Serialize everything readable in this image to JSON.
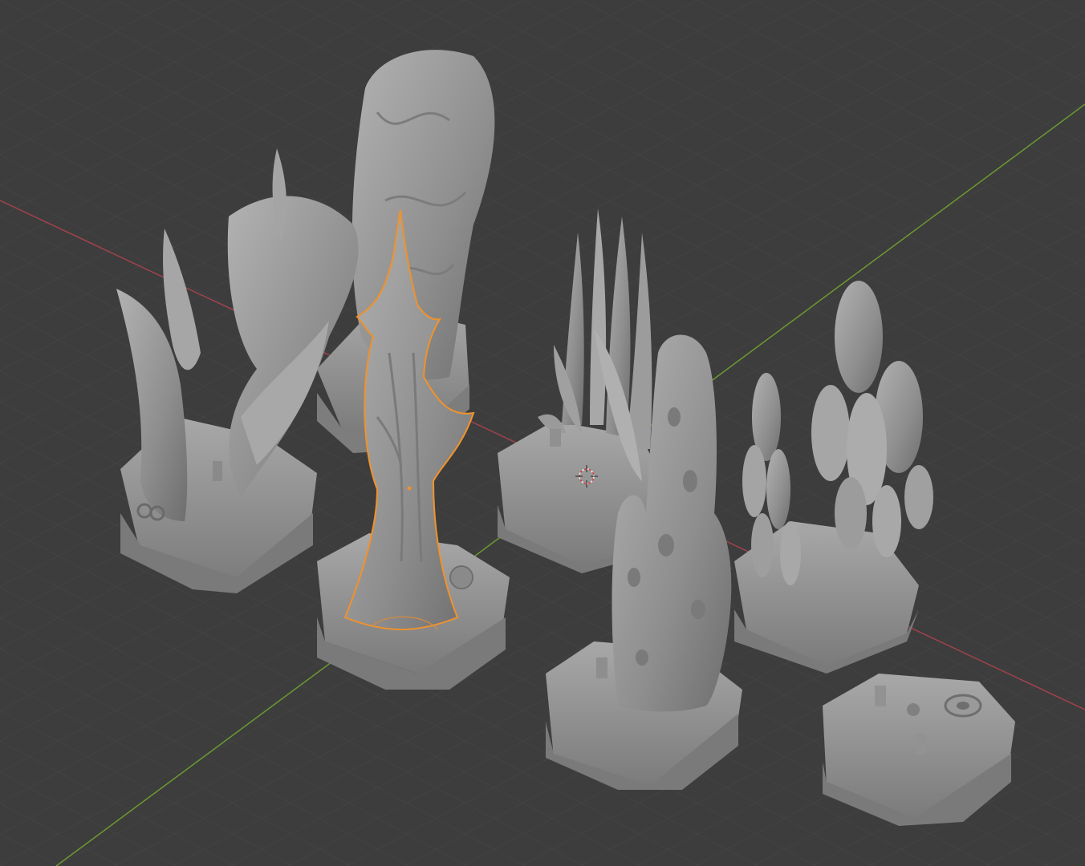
{
  "app": "Blender",
  "viewport": {
    "mode": "3d-viewport",
    "background_color": "#3d3d3d",
    "grid_color": "#4a4a4a",
    "x_axis_color": "#a0424e",
    "y_axis_color": "#6a9a30",
    "selection_outline_color": "#f0922c",
    "mesh_color": "#9a9a9a"
  },
  "objects": [
    {
      "name": "fin-tree-terrain-tile",
      "selected": false
    },
    {
      "name": "boulder-pillar-terrain-tile",
      "selected": false
    },
    {
      "name": "spiked-tree-terrain-tile",
      "selected": true
    },
    {
      "name": "kelp-grass-terrain-tile",
      "selected": false
    },
    {
      "name": "pitted-coral-terrain-tile",
      "selected": false
    },
    {
      "name": "pod-plant-terrain-tile",
      "selected": false
    },
    {
      "name": "empty-hex-base-tile",
      "selected": false
    }
  ],
  "cursor": {
    "icon": "3d-cursor-icon"
  }
}
